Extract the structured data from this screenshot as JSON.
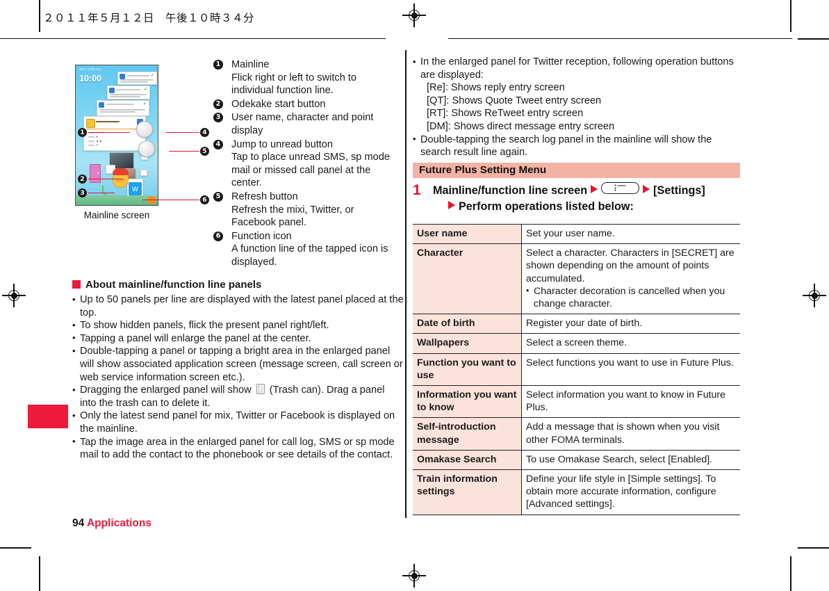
{
  "header": {
    "date_time": "２０１１年５月１２日　午後１０時３４分"
  },
  "figure": {
    "caption": "Mainline screen",
    "phone_clock": "10:00",
    "phone_datestr": "2011 10/28 Sun",
    "callout_numbers": [
      "1",
      "2",
      "3",
      "4",
      "5",
      "6"
    ]
  },
  "legend": {
    "items": [
      {
        "num": "1",
        "title": "Mainline",
        "desc": "Flick right or left to switch to individual function line."
      },
      {
        "num": "2",
        "title": "Odekake start button",
        "desc": ""
      },
      {
        "num": "3",
        "title": "User name, character and point display",
        "desc": ""
      },
      {
        "num": "4",
        "title": "Jump to unread button",
        "desc": "Tap to place unread SMS, sp mode mail or missed call panel at the center."
      },
      {
        "num": "5",
        "title": "Refresh button",
        "desc": "Refresh the mixi, Twitter, or Facebook panel."
      },
      {
        "num": "6",
        "title": "Function icon",
        "desc": "A function line of the tapped icon is displayed."
      }
    ]
  },
  "about_section": {
    "heading": "About mainline/function line panels",
    "bullets": [
      "Up to 50 panels per line are displayed with the latest panel placed at the top.",
      "To show hidden panels, flick the present panel right/left.",
      "Tapping a panel will enlarge the panel at the center.",
      "Double-tapping a panel or tapping a bright area in the enlarged panel will show associated application screen (message screen, call screen or web service information screen etc.).",
      "Only the latest send panel for mix, Twitter or Facebook is displayed on the mainline.",
      "Tap the image area in the enlarged panel for call log, SMS or sp mode mail to add the contact to the phonebook or see details of the contact."
    ],
    "trash_bullet": {
      "before": "Dragging the enlarged panel will show",
      "after": "(Trash can). Drag a panel into the trash can to delete it.",
      "icon": "trash-can-icon"
    }
  },
  "right_bullets": {
    "twitter_intro": "In the enlarged panel for Twitter reception, following operation buttons are displayed:",
    "twitter_lines": [
      "[Re]: Shows reply entry screen",
      "[QT]: Shows Quote Tweet entry screen",
      "[RT]: Shows ReTweet entry screen",
      "[DM]: Shows direct message entry screen"
    ],
    "search_log": "Double-tapping the search log panel in the mainline will show the search result line again."
  },
  "section": {
    "title": "Future Plus Setting Menu"
  },
  "step": {
    "number": "1",
    "line1_a": "Mainline/function line screen",
    "key_icon": "menu-list-key-icon",
    "line1_b": "[Settings]",
    "line2": "Perform operations listed below:"
  },
  "settings_table": {
    "rows": [
      {
        "label": "User name",
        "desc": "Set your user name.",
        "bullet": ""
      },
      {
        "label": "Character",
        "desc": "Select a character. Characters in [SECRET] are shown depending on the amount of points accumulated.",
        "bullet": "Character decoration is cancelled when you change character."
      },
      {
        "label": "Date of birth",
        "desc": "Register your date of birth.",
        "bullet": ""
      },
      {
        "label": "Wallpapers",
        "desc": "Select a screen theme.",
        "bullet": ""
      },
      {
        "label": "Function you want to use",
        "desc": "Select functions you want to use in Future Plus.",
        "bullet": ""
      },
      {
        "label": "Information you want to know",
        "desc": "Select information you want to know in Future Plus.",
        "bullet": ""
      },
      {
        "label": "Self-introduction message",
        "desc": "Add a message that is shown when you visit other FOMA terminals.",
        "bullet": ""
      },
      {
        "label": "Omakase Search",
        "desc": "To use Omakase Search, select [Enabled].",
        "bullet": ""
      },
      {
        "label": "Train information settings",
        "desc": "Define your life style in [Simple settings]. To obtain more accurate information, configure [Advanced settings].",
        "bullet": ""
      }
    ]
  },
  "footer": {
    "page_number": "94",
    "section_name": "Applications"
  },
  "colors": {
    "accent_red": "#ed1a3b",
    "section_pink": "#f2b3a4",
    "table_label_bg": "#fbe3dc",
    "leader_red": "#e8112d"
  }
}
